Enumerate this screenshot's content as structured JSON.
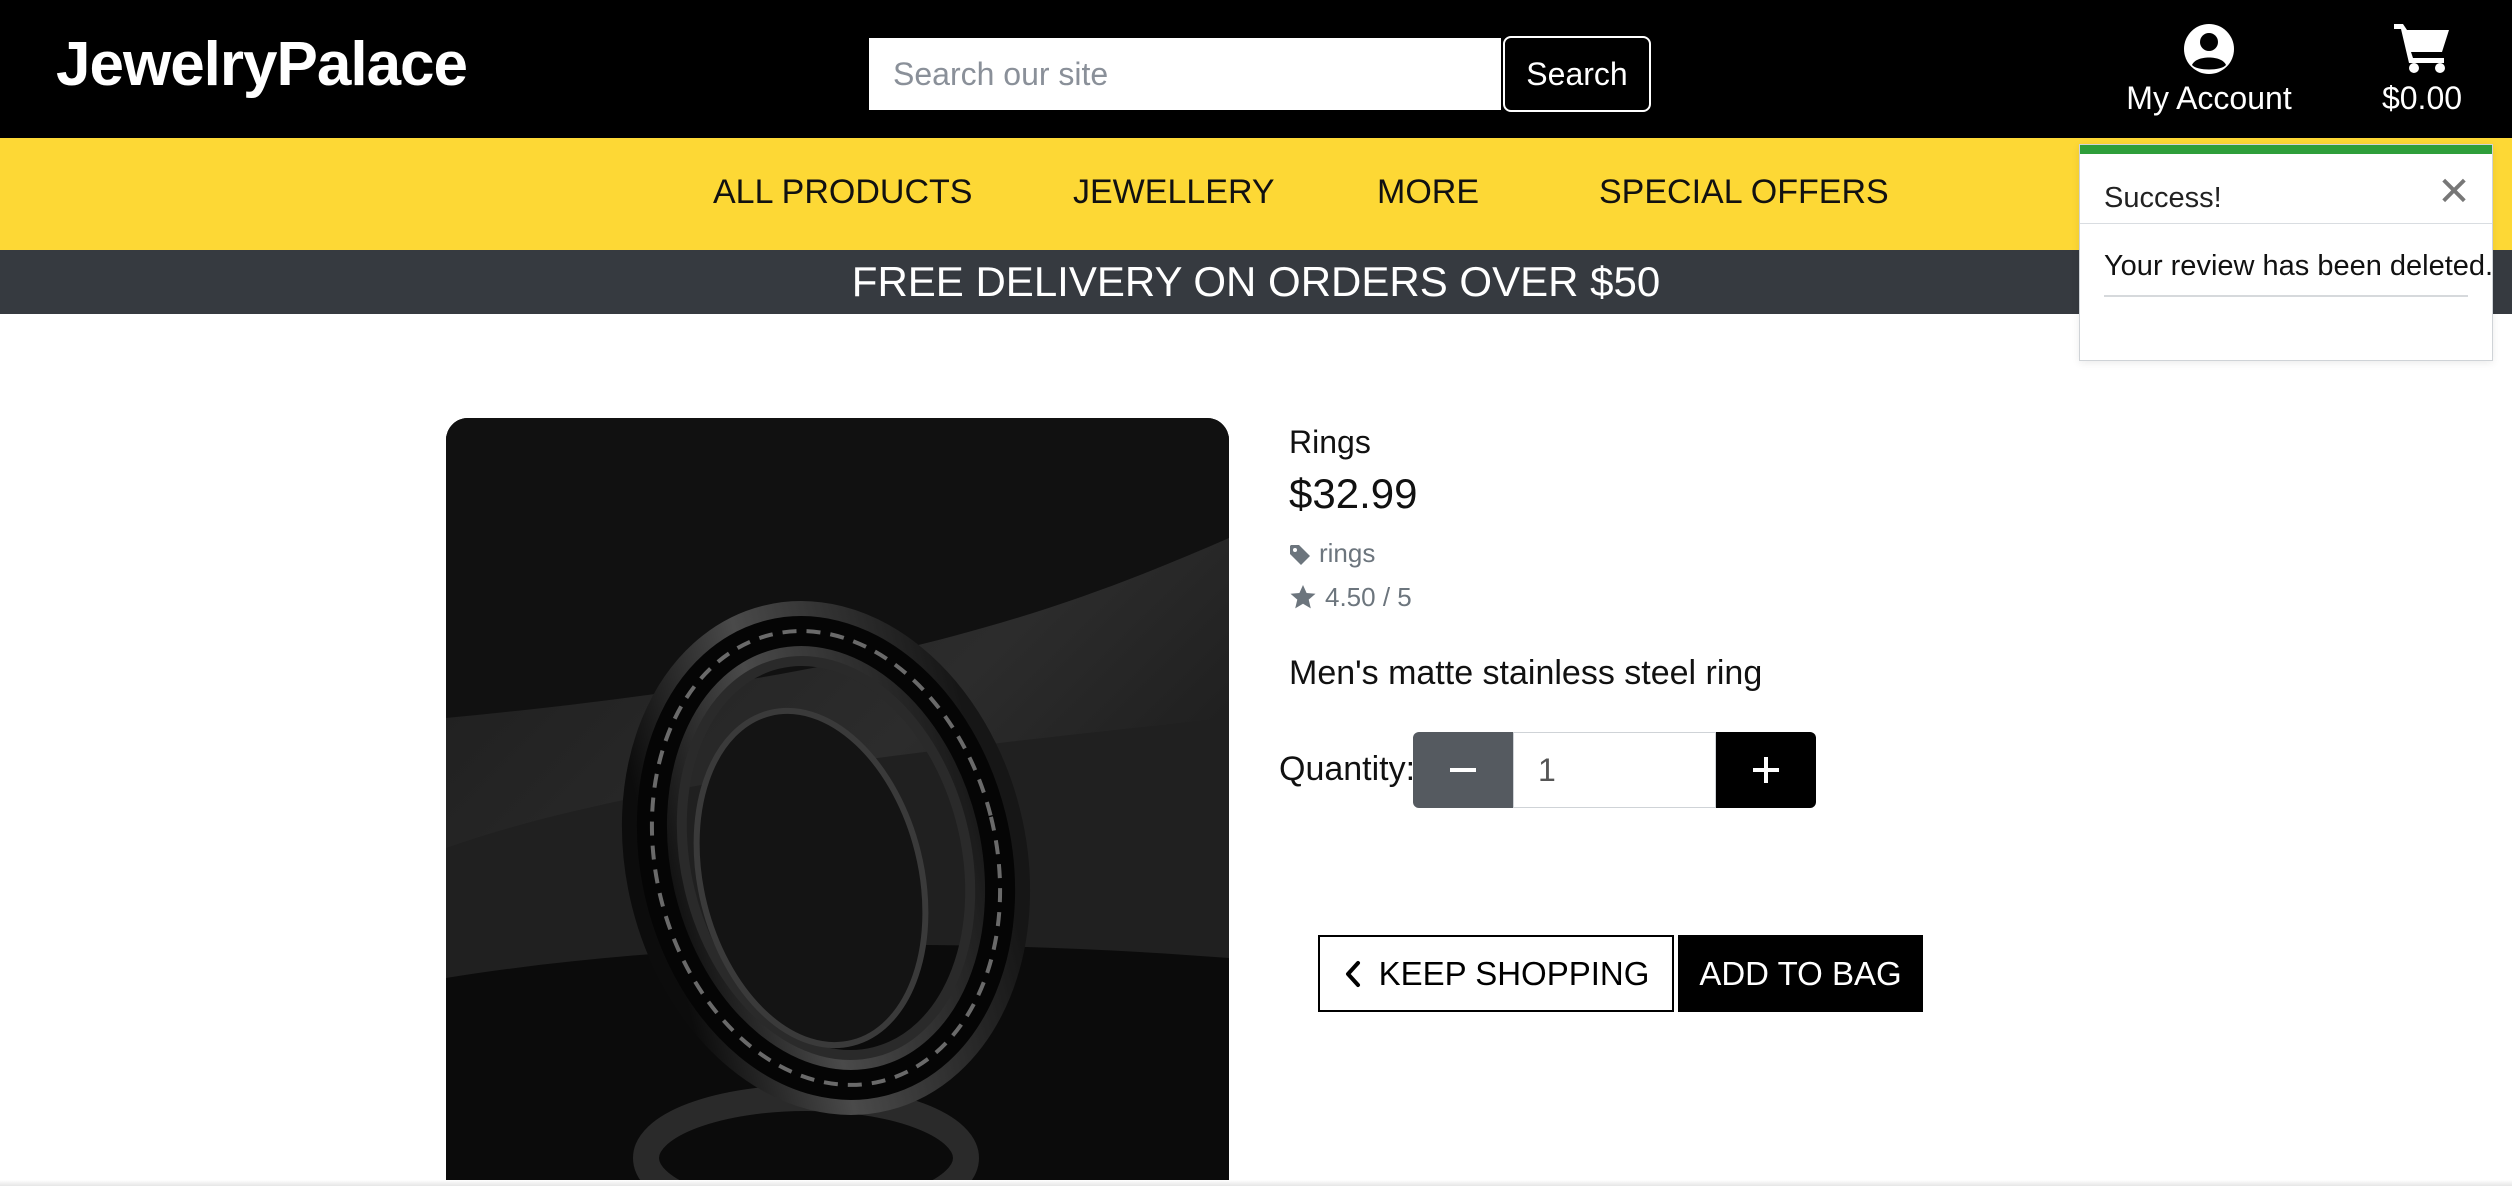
{
  "header": {
    "brand": "JewelryPalace",
    "search_placeholder": "Search our site",
    "search_label": "Search",
    "account_label": "My Account",
    "account_icon": "user-circle-icon",
    "cart_total": "$0.00",
    "cart_icon": "shopping-cart-icon"
  },
  "nav": {
    "items": [
      "ALL PRODUCTS",
      "JEWELLERY",
      "MORE",
      "SPECIAL OFFERS"
    ]
  },
  "banner": {
    "text": "FREE DELIVERY ON ORDERS OVER $50"
  },
  "toast": {
    "title": "Success!",
    "message": "Your review has been deleted.",
    "close_icon": "close-icon",
    "accent_color": "#2e9e3a"
  },
  "product": {
    "image_subject": "black stainless steel chain ring",
    "category": "Rings",
    "price": "$32.99",
    "tag": "rings",
    "tag_icon": "tag-icon",
    "rating": "4.50 / 5",
    "rating_icon": "star-icon",
    "description": "Men's matte stainless steel ring"
  },
  "quantity": {
    "label": "Quantity:",
    "value": "1",
    "minus_icon": "minus-icon",
    "plus_icon": "plus-icon"
  },
  "actions": {
    "keep_shopping": "KEEP SHOPPING",
    "keep_shopping_icon": "chevron-left-icon",
    "add_to_bag": "ADD TO BAG"
  },
  "colors": {
    "header_bg": "#000000",
    "nav_bg": "#fdd835",
    "banner_bg": "#363a40"
  }
}
